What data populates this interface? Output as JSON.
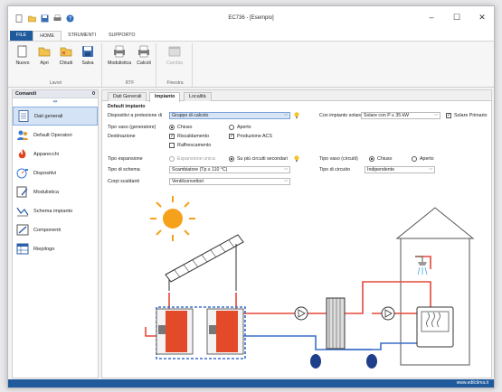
{
  "window": {
    "title": "EC736 - [Esempio]"
  },
  "ribbon_tabs": [
    "FILE",
    "HOME",
    "STRUMENTI",
    "SUPPORTO"
  ],
  "ribbon": {
    "groups": [
      {
        "label": "Lavori",
        "buttons": [
          "Nuovo",
          "Apri",
          "Chiudi",
          "Salva"
        ]
      },
      {
        "label": "RTF",
        "buttons": [
          "Modulistica",
          "Calcoli"
        ]
      },
      {
        "label": "Finestra",
        "buttons": [
          "Cambia"
        ]
      }
    ]
  },
  "left_panel": {
    "header": "Comandi",
    "header_value": "0",
    "pin_icon": "pin-icon",
    "items": [
      {
        "label": "Dati generali",
        "icon": "doc-icon",
        "selected": true
      },
      {
        "label": "Default Operatori",
        "icon": "users-icon"
      },
      {
        "label": "Apparecchi",
        "icon": "flame-icon"
      },
      {
        "label": "Dispositivi",
        "icon": "gauge-icon"
      },
      {
        "label": "Modulistica",
        "icon": "form-icon"
      },
      {
        "label": "Schema impianto",
        "icon": "chart-icon"
      },
      {
        "label": "Componenti",
        "icon": "component-icon"
      },
      {
        "label": "Riepilogo",
        "icon": "table-icon"
      }
    ]
  },
  "page_tabs": [
    "Dati Generali",
    "Impianto",
    "Località"
  ],
  "form": {
    "section_title": "Default impianto",
    "dispositivi_label": "Dispositivi a protezione di",
    "dispositivi_value": "Gruppo di calcolo",
    "con_impianto_solare_label": "Con impianto solare",
    "con_impianto_solare_value": "Solare con P ≤ 35 kW",
    "solare_primario_label": "Solare Primario",
    "tipo_vaso_gen_label": "Tipo vaso (generatore)",
    "chiuso": "Chiuso",
    "aperto": "Aperto",
    "destinazione_label": "Destinazione",
    "riscaldamento": "Riscaldamento",
    "produzione_acs": "Produzione ACS",
    "raffrescamento": "Raffrescamento",
    "tipo_espansione_label": "Tipo espansione",
    "espansione_unica": "Espansione unica",
    "su_piu_circuiti": "Su più circuiti secondari",
    "tipo_vaso_circ_label": "Tipo vaso (circuiti)",
    "tipo_schema_label": "Tipo di schema",
    "tipo_schema_value": "Scambiatore (Tp ≥ 110 °C)",
    "tipo_circuito_label": "Tipo di circuito",
    "tipo_circuito_value": "Indipendente",
    "corpi_scaldanti_label": "Corpi scaldanti",
    "corpi_scaldanti_value": "Ventilconvettori"
  },
  "statusbar": {
    "text": "www.edilclima.it"
  }
}
